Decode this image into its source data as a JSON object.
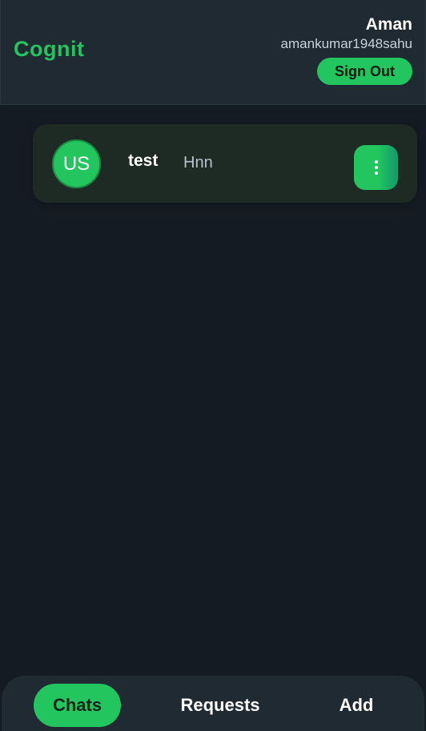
{
  "header": {
    "brand": "Cognit",
    "user_name": "Aman",
    "user_handle": "amankumar1948sahu",
    "signout_label": "Sign Out"
  },
  "chats": [
    {
      "avatar_initials": "US",
      "name": "test",
      "preview": "Hnn",
      "menu_icon": "more-vertical-icon"
    }
  ],
  "nav": {
    "tabs": [
      {
        "label": "Chats",
        "active": true
      },
      {
        "label": "Requests",
        "active": false
      },
      {
        "label": "Add",
        "active": false
      }
    ]
  },
  "colors": {
    "accent": "#22c55e",
    "background": "#141b22",
    "panel": "#1f2a33",
    "card": "#1e2b25"
  }
}
